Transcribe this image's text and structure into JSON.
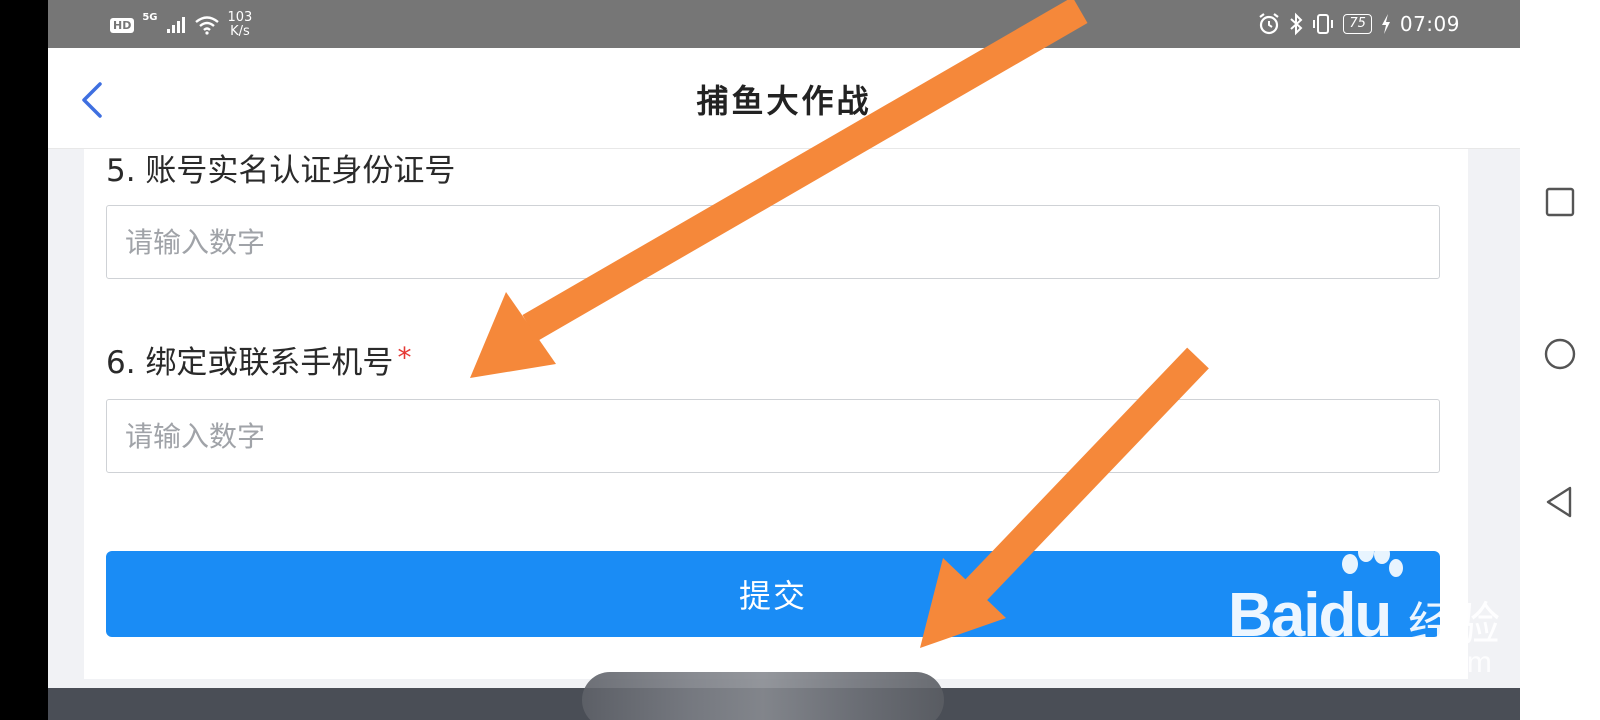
{
  "status_bar": {
    "hd": "HD",
    "network": "5G",
    "speed_value": "103",
    "speed_unit": "K/s",
    "battery": "75",
    "time": "07:09"
  },
  "nav": {
    "title": "捕鱼大作战"
  },
  "form": {
    "q5_label": "5. 账号实名认证身份证号",
    "q5_placeholder": "请输入数字",
    "q6_label": "6. 绑定或联系手机号",
    "q6_required": "*",
    "q6_placeholder": "请输入数字",
    "submit_label": "提交"
  },
  "watermark": {
    "brand": "Baidu",
    "product": "经验",
    "url": "jingyan.baidu.com"
  },
  "colors": {
    "primary_button": "#1a8cf5",
    "required_star": "#e53935",
    "arrow": "#f5883a",
    "status_bar": "#767676",
    "back_chevron": "#3f6fe0"
  },
  "icons": [
    "back-chevron-icon",
    "alarm-icon",
    "bluetooth-icon",
    "vibrate-icon",
    "battery-icon",
    "charging-icon",
    "wifi-icon",
    "signal-icon",
    "recent-apps-icon",
    "home-icon",
    "back-triangle-icon"
  ]
}
